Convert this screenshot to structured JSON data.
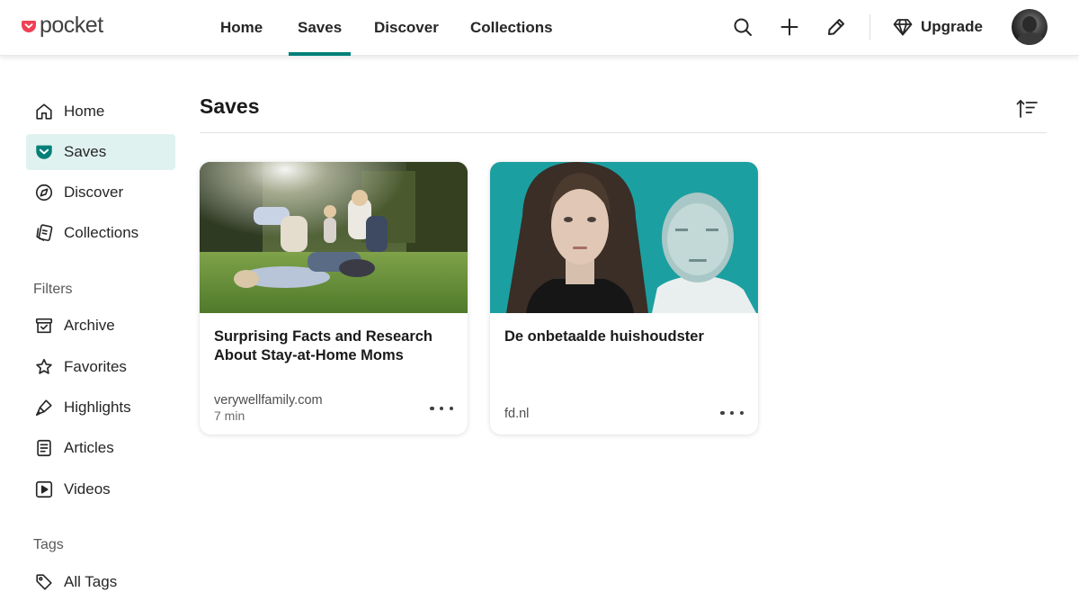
{
  "brand": {
    "name": "pocket",
    "accent": "#ef4056",
    "active_color": "#008078"
  },
  "topnav": {
    "tabs": [
      {
        "label": "Home",
        "active": false
      },
      {
        "label": "Saves",
        "active": true
      },
      {
        "label": "Discover",
        "active": false
      },
      {
        "label": "Collections",
        "active": false
      }
    ],
    "actions": {
      "search_icon": "search-icon",
      "add_icon": "plus-icon",
      "edit_icon": "pencil-icon"
    },
    "upgrade_label": "Upgrade"
  },
  "sidebar": {
    "nav": [
      {
        "label": "Home",
        "icon": "home-icon",
        "active": false
      },
      {
        "label": "Saves",
        "icon": "pocket-icon",
        "active": true
      },
      {
        "label": "Discover",
        "icon": "compass-icon",
        "active": false
      },
      {
        "label": "Collections",
        "icon": "collections-icon",
        "active": false
      }
    ],
    "filters_heading": "Filters",
    "filters": [
      {
        "label": "Archive",
        "icon": "archive-icon"
      },
      {
        "label": "Favorites",
        "icon": "star-icon"
      },
      {
        "label": "Highlights",
        "icon": "highlighter-icon"
      },
      {
        "label": "Articles",
        "icon": "article-icon"
      },
      {
        "label": "Videos",
        "icon": "video-icon"
      }
    ],
    "tags_heading": "Tags",
    "tags": [
      {
        "label": "All Tags",
        "icon": "tag-icon"
      }
    ]
  },
  "main": {
    "title": "Saves",
    "sort_icon": "sort-icon",
    "cards": [
      {
        "title": "Surprising Facts and Research About Stay-at-Home Moms",
        "domain": "verywellfamily.com",
        "read_time": "7 min",
        "image": "photo of a family playing on the grass"
      },
      {
        "title": "De onbetaalde huishoudster",
        "domain": "fd.nl",
        "read_time": "",
        "image": "portrait of a woman and a man on a teal background"
      }
    ]
  }
}
